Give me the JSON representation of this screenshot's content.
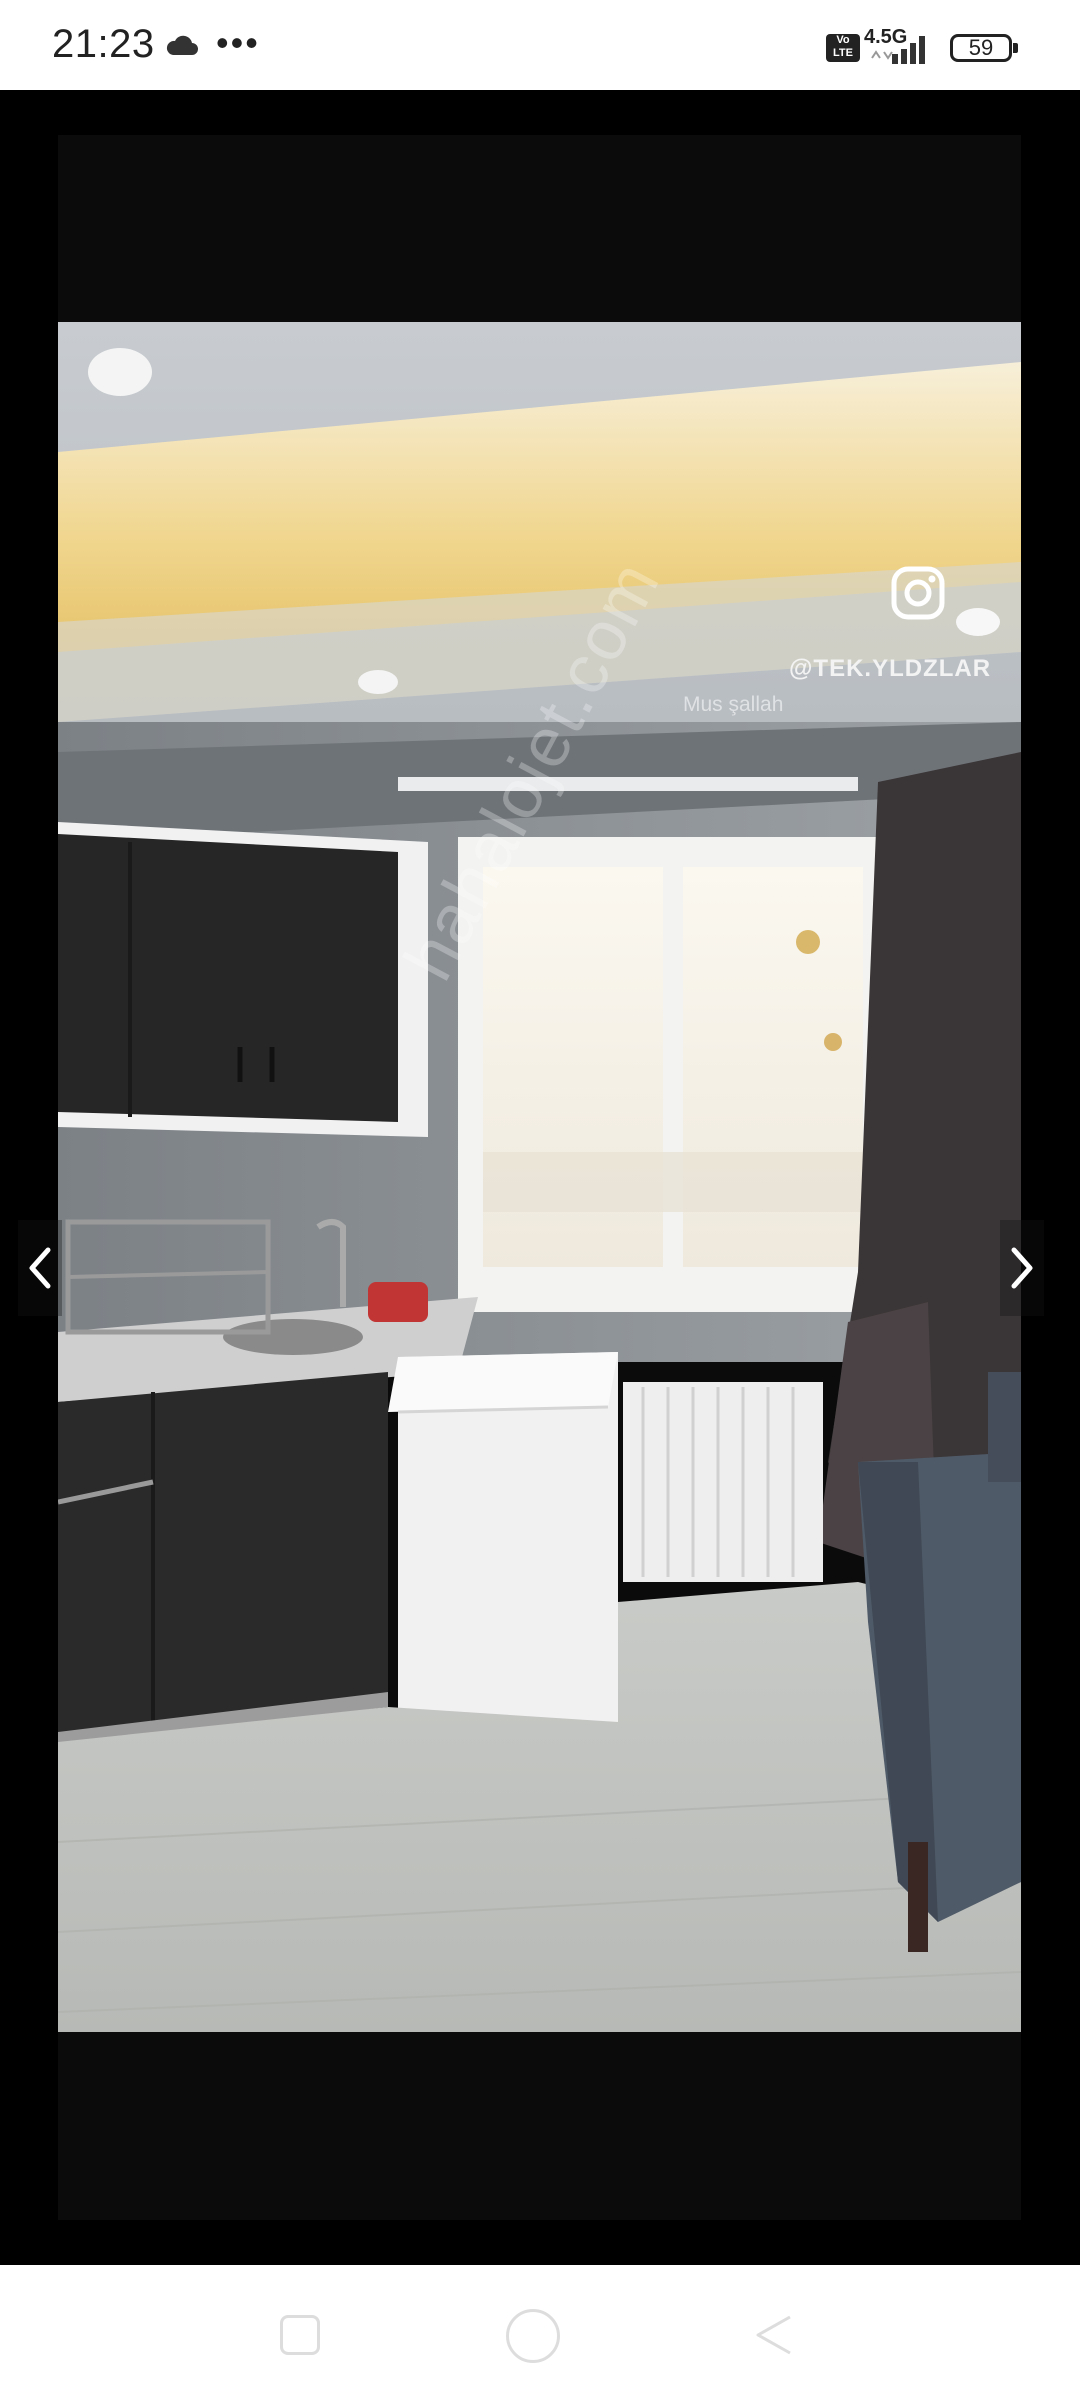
{
  "status_bar": {
    "time": "21:23",
    "network_label": "4.5G",
    "volte_label": "Vo\nLTE",
    "battery": "59",
    "icons": [
      "cloud-icon",
      "more-dots-icon",
      "volte-icon",
      "signal-icon",
      "battery-icon"
    ]
  },
  "viewer": {
    "overlay_handle": "@TEK.YLDZLAR",
    "overlay_caption": "Mus                  şallah",
    "watermark": "hahalojet.com",
    "nav_icons": [
      "chevron-left-icon",
      "chevron-right-icon"
    ]
  },
  "nav_bar": {
    "icons": [
      "recents-icon",
      "home-icon",
      "back-icon"
    ]
  },
  "colors": {
    "status_bg": "#ffffff",
    "viewer_bg": "#000000",
    "ceiling_light": "#f2d690",
    "cabinet": "#2b2b2b",
    "floor": "#c9c9c4"
  }
}
